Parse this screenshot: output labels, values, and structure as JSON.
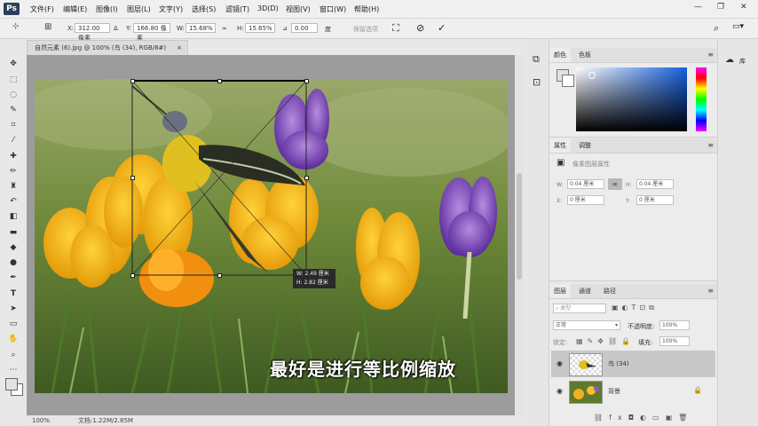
{
  "app": {
    "logo": "Ps"
  },
  "menu": [
    "文件(F)",
    "编辑(E)",
    "图像(I)",
    "图层(L)",
    "文字(Y)",
    "选择(S)",
    "滤镜(T)",
    "3D(D)",
    "视图(V)",
    "窗口(W)",
    "帮助(H)"
  ],
  "window_controls": {
    "minimize": "—",
    "restore": "❐",
    "close": "✕"
  },
  "options": {
    "x_label": "X:",
    "x_value": "312.00 像素",
    "y_label": "Y:",
    "y_value": "166.80 像素",
    "w_label": "W:",
    "w_value": "15.68%",
    "h_label": "H:",
    "h_value": "15.65%",
    "angle_value": "0.00",
    "angle_unit": "度",
    "interp_label": "保留选项"
  },
  "document": {
    "tab_title": "自然元素 (6).jpg @ 100% (鸟 (34), RGB/8#)",
    "tab_close": "×"
  },
  "status": {
    "zoom": "100%",
    "doc": "文档:1.22M/2.85M"
  },
  "transform_tip": {
    "w": "W: 2.49 厘米",
    "h": "H: 2.82 厘米"
  },
  "subtitle": "最好是进行等比例缩放",
  "color_panel": {
    "tabs": [
      "颜色",
      "色板"
    ]
  },
  "properties_panel": {
    "tabs": [
      "属性",
      "调整"
    ],
    "title": "像素图层属性",
    "w_label": "W:",
    "w_value": "0.04 厘米",
    "h_label": "H:",
    "h_value": "0.04 厘米",
    "x_label": "X:",
    "x_value": "0 厘米",
    "y_label": "Y:",
    "y_value": "0 厘米"
  },
  "layers_panel": {
    "tabs": [
      "图层",
      "通道",
      "路径"
    ],
    "filter_label": "类型",
    "blend_mode": "正常",
    "opacity_label": "不透明度:",
    "opacity_value": "100%",
    "lock_label": "锁定:",
    "fill_label": "填充:",
    "fill_value": "100%",
    "layers": [
      {
        "name": "鸟 (34)"
      },
      {
        "name": "背景"
      }
    ]
  },
  "side_panel": {
    "library_label": "库"
  },
  "colors": {
    "accent": "#2c3e5c",
    "selection": "#c8c8c8"
  }
}
